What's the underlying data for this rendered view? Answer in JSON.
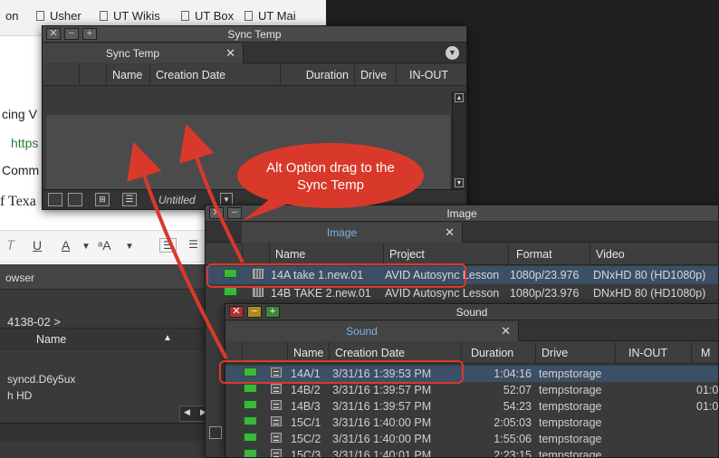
{
  "background": {
    "bookmarks": [
      {
        "label": "on"
      },
      {
        "label": "Usher"
      },
      {
        "label": "UT Wikis"
      },
      {
        "label": "UT Box"
      },
      {
        "label": "UT Mai"
      }
    ],
    "doc_lines": [
      "cing V",
      "https",
      "Comm",
      "f Texa"
    ],
    "toolbar": {
      "underline": "U",
      "font_color": "A",
      "font_size": "ᵃA"
    },
    "finder": {
      "title": "owser",
      "path": "4138-02 >",
      "name_header": "Name",
      "items": [
        "syncd.D6y5ux",
        "h HD"
      ]
    }
  },
  "sync_window": {
    "title": "Sync Temp",
    "tab": "Sync Temp",
    "columns": [
      "Name",
      "Creation Date",
      "Duration",
      "Drive",
      "IN-OUT"
    ],
    "footer_label": "Untitled"
  },
  "image_window": {
    "title": "Image",
    "tab": "Image",
    "columns": [
      "Name",
      "Project",
      "Format",
      "Video"
    ],
    "rows": [
      {
        "name": "14A take 1.new.01",
        "project": "AVID Autosync Lesson",
        "format": "1080p/23.976",
        "video": "DNxHD 80 (HD1080p)"
      },
      {
        "name": "14B TAKE 2.new.01",
        "project": "AVID Autosync Lesson",
        "format": "1080p/23.976",
        "video": "DNxHD 80 (HD1080p)"
      }
    ]
  },
  "sound_window": {
    "title": "Sound",
    "tab": "Sound",
    "columns": [
      "Name",
      "Creation Date",
      "Duration",
      "Drive",
      "IN-OUT",
      "M"
    ],
    "rows": [
      {
        "name": "14A/1",
        "date": "3/31/16 1:39:53 PM",
        "duration": "1:04:16",
        "drive": "tempstorage",
        "extra": ""
      },
      {
        "name": "14B/2",
        "date": "3/31/16 1:39:57 PM",
        "duration": "52:07",
        "drive": "tempstorage",
        "extra": "01:0"
      },
      {
        "name": "14B/3",
        "date": "3/31/16 1:39:57 PM",
        "duration": "54:23",
        "drive": "tempstorage",
        "extra": "01:0"
      },
      {
        "name": "15C/1",
        "date": "3/31/16 1:40:00 PM",
        "duration": "2:05:03",
        "drive": "tempstorage",
        "extra": ""
      },
      {
        "name": "15C/2",
        "date": "3/31/16 1:40:00 PM",
        "duration": "1:55:06",
        "drive": "tempstorage",
        "extra": ""
      },
      {
        "name": "15C/3",
        "date": "3/31/16 1:40:01 PM",
        "duration": "2:23:15",
        "drive": "tempstorage",
        "extra": ""
      }
    ]
  },
  "annotation": {
    "text": "Alt Option drag to the Sync Temp",
    "color": "#d9392a"
  },
  "colors": {
    "selected_row": "#3b4f66",
    "clip_swatch": "#3fb53f",
    "sound_tab_text": "#7fb3e6"
  }
}
